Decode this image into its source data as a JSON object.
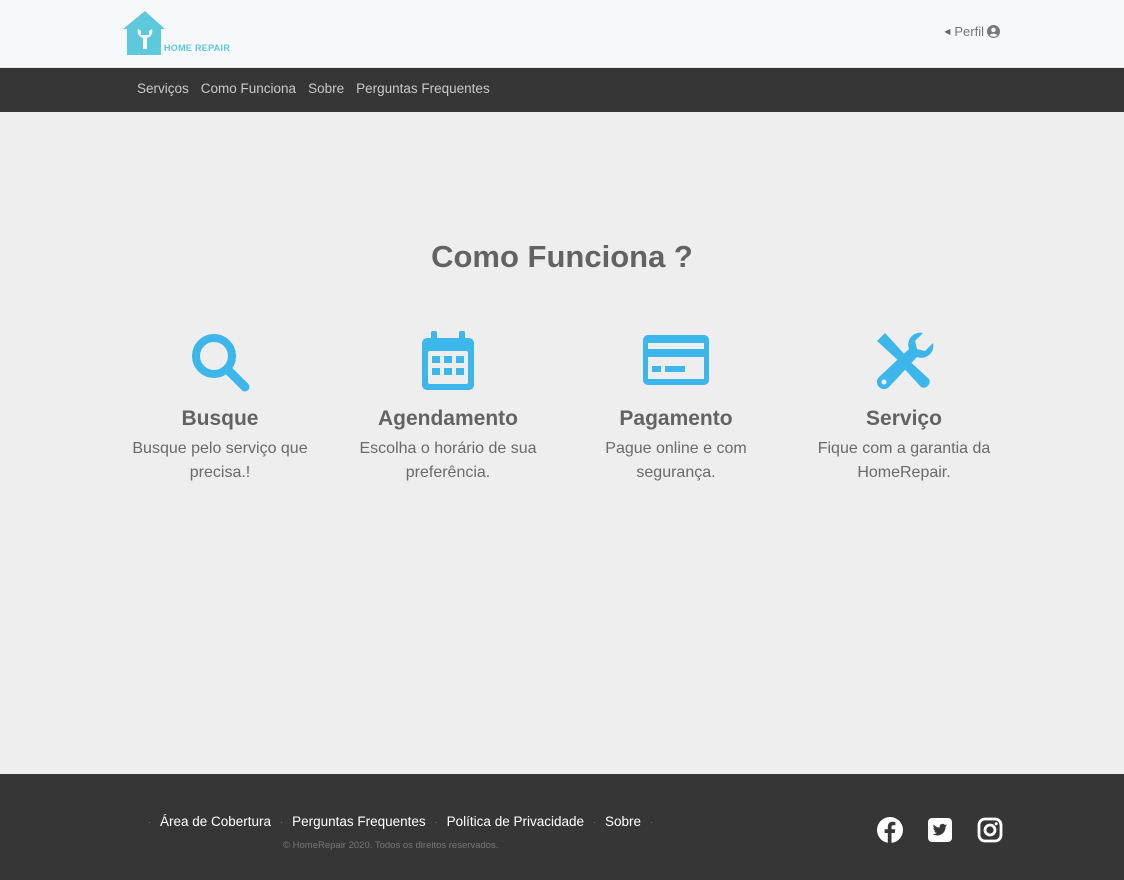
{
  "header": {
    "logo_text": "HOME REPAIR",
    "profile_label": "Perfil",
    "profile_caret_icon": "caret-left-icon",
    "profile_user_icon": "user-circle-icon"
  },
  "nav": {
    "items": [
      "Serviços",
      "Como Funciona",
      "Sobre",
      "Perguntas Frequentes"
    ]
  },
  "main": {
    "title": "Como Funciona ?",
    "accent_color": "#3db6ec",
    "steps": [
      {
        "icon": "search-icon",
        "title": "Busque",
        "desc": "Busque pelo serviço que precisa.!"
      },
      {
        "icon": "calendar-icon",
        "title": "Agendamento",
        "desc": "Escolha o horário de sua preferência."
      },
      {
        "icon": "credit-card-icon",
        "title": "Pagamento",
        "desc": "Pague online e com segurança."
      },
      {
        "icon": "tools-icon",
        "title": "Serviço",
        "desc": "Fique com a garantia da HomeRepair."
      }
    ]
  },
  "footer": {
    "links": [
      "Área de Cobertura",
      "Perguntas Frequentes",
      "Política de Privacidade",
      "Sobre"
    ],
    "separator": "·",
    "copyright": "© HomeRepair 2020. Todos os direitos reservados.",
    "socials": [
      "facebook-icon",
      "twitter-icon",
      "instagram-icon"
    ]
  }
}
